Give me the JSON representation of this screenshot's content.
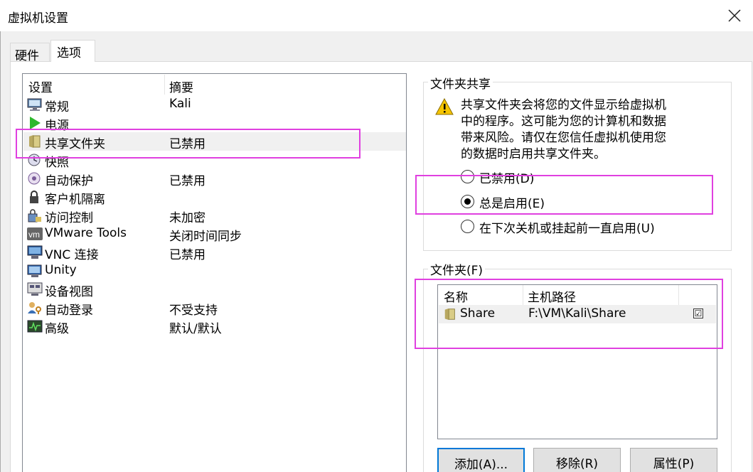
{
  "window": {
    "title": "虚拟机设置"
  },
  "tabs": [
    {
      "label": "硬件"
    },
    {
      "label": "选项"
    }
  ],
  "list": {
    "headers": {
      "setting": "设置",
      "summary": "摘要"
    },
    "items": [
      {
        "label": "常规",
        "summary": "Kali",
        "icon": "monitor-icon"
      },
      {
        "label": "电源",
        "summary": "",
        "icon": "play-icon"
      },
      {
        "label": "共享文件夹",
        "summary": "已禁用",
        "icon": "folder-icon"
      },
      {
        "label": "快照",
        "summary": "",
        "icon": "snapshot-icon"
      },
      {
        "label": "自动保护",
        "summary": "已禁用",
        "icon": "autoprotect-icon"
      },
      {
        "label": "客户机隔离",
        "summary": "",
        "icon": "lock-icon"
      },
      {
        "label": "访问控制",
        "summary": "未加密",
        "icon": "access-control-icon"
      },
      {
        "label": "VMware Tools",
        "summary": "关闭时间同步",
        "icon": "vm-icon"
      },
      {
        "label": "VNC 连接",
        "summary": "已禁用",
        "icon": "vnc-icon"
      },
      {
        "label": "Unity",
        "summary": "",
        "icon": "unity-icon"
      },
      {
        "label": "设备视图",
        "summary": "",
        "icon": "device-view-icon"
      },
      {
        "label": "自动登录",
        "summary": "不受支持",
        "icon": "autologin-icon"
      },
      {
        "label": "高级",
        "summary": "默认/默认",
        "icon": "advanced-icon"
      }
    ]
  },
  "sharing": {
    "title": "文件夹共享",
    "warning": "共享文件夹会将您的文件显示给虚拟机中的程序。这可能为您的计算机和数据带来风险。请仅在您信任虚拟机使用您的数据时启用共享文件夹。",
    "warning_lines": [
      "共享文件夹会将您的文件显示给虚拟机",
      "中的程序。这可能为您的计算机和数据",
      "带来风险。请仅在您信任虚拟机使用您",
      "的数据时启用共享文件夹。"
    ],
    "options": [
      {
        "label": "已禁用(D)",
        "selected": false
      },
      {
        "label": "总是启用(E)",
        "selected": true
      },
      {
        "label": "在下次关机或挂起前一直启用(U)",
        "selected": false
      }
    ]
  },
  "folders": {
    "title": "文件夹(F)",
    "headers": {
      "name": "名称",
      "path": "主机路径"
    },
    "rows": [
      {
        "name": "Share",
        "path": "F:\\VM\\Kali\\Share",
        "enabled": true,
        "check": "☑"
      }
    ],
    "buttons": {
      "add": "添加(A)...",
      "remove": "移除(R)",
      "properties": "属性(P)"
    }
  },
  "colors": {
    "highlight": "#e040e0",
    "selection": "#f0f0f0",
    "accent": "#0078d7"
  }
}
